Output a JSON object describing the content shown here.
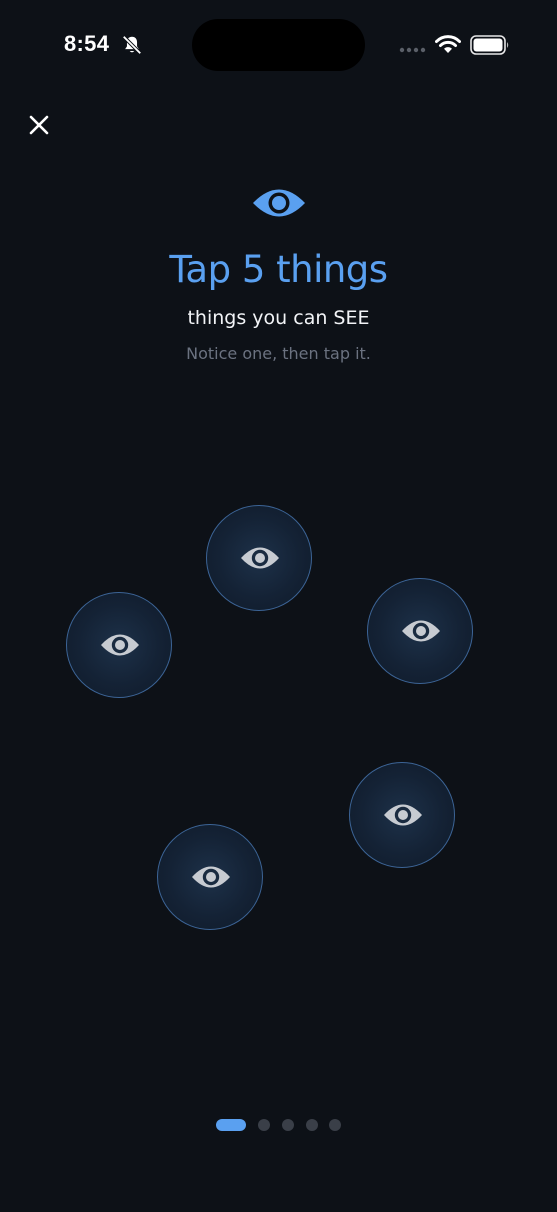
{
  "status_bar": {
    "time": "8:54",
    "icons": [
      "bell-slash-icon",
      "signal-icon",
      "wifi-icon",
      "battery-icon"
    ]
  },
  "header": {
    "close_icon": "close-icon",
    "icon": "eye-icon",
    "title": "Tap 5 things",
    "subtitle": "things you can SEE",
    "hint": "Notice one, then tap it."
  },
  "targets": {
    "count": 5,
    "icon": "eye-icon"
  },
  "pager": {
    "total": 5,
    "current": 1
  },
  "colors": {
    "background": "#0d1117",
    "accent": "#5aa0f0",
    "bubble_border": "#3c6496",
    "eye_gray": "#c7cbd1"
  }
}
